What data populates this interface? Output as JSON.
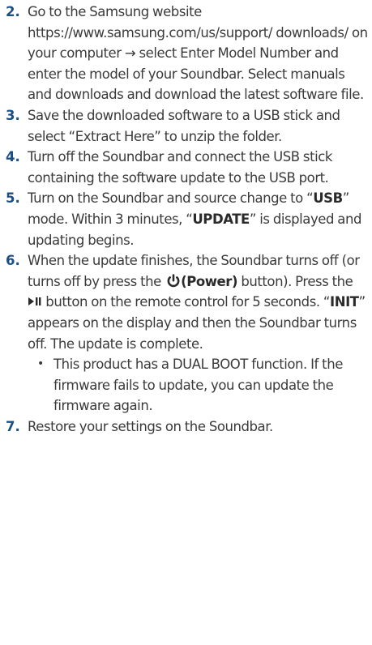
{
  "steps": [
    {
      "number": "2.",
      "text": "Go to the Samsung website https://www.samsung.com/us/support/ downloads/ on your computer → select Enter Model Number and enter the model of your Soundbar. Select manuals and downloads and download the latest software file."
    },
    {
      "number": "3.",
      "text": "Save the downloaded software to a USB stick and select “Extract Here” to unzip the folder."
    },
    {
      "number": "4.",
      "text": "Turn off the Soundbar and connect the USB stick containing the software update to the USB port."
    },
    {
      "number": "5.",
      "pre": "Turn on the Soundbar and source change to “",
      "usb": "USB",
      "mid": "” mode. Within 3 minutes, “",
      "update": "UPDATE",
      "post": "” is displayed and updating begins."
    },
    {
      "number": "6.",
      "pre": "When the update finishes, the Soundbar turns off (or turns off by press the ",
      "power_label": "(Power)",
      "mid1": " button). Press the ",
      "mid2": " button on the remote control for 5 seconds. “",
      "init": "INIT",
      "post": "” appears on the display and then the Soundbar turns off. The update is complete.",
      "bullet_char": "•",
      "bullet": "This product has a DUAL BOOT function. If the firmware fails to update, you can update the firmware again."
    },
    {
      "number": "7.",
      "text": "Restore your settings on the Soundbar."
    }
  ],
  "icons": {
    "power": "power-icon",
    "play_pause": "play-pause-icon"
  },
  "colors": {
    "step_number": "#1a4f86",
    "body_text": "#3a3a3a"
  }
}
